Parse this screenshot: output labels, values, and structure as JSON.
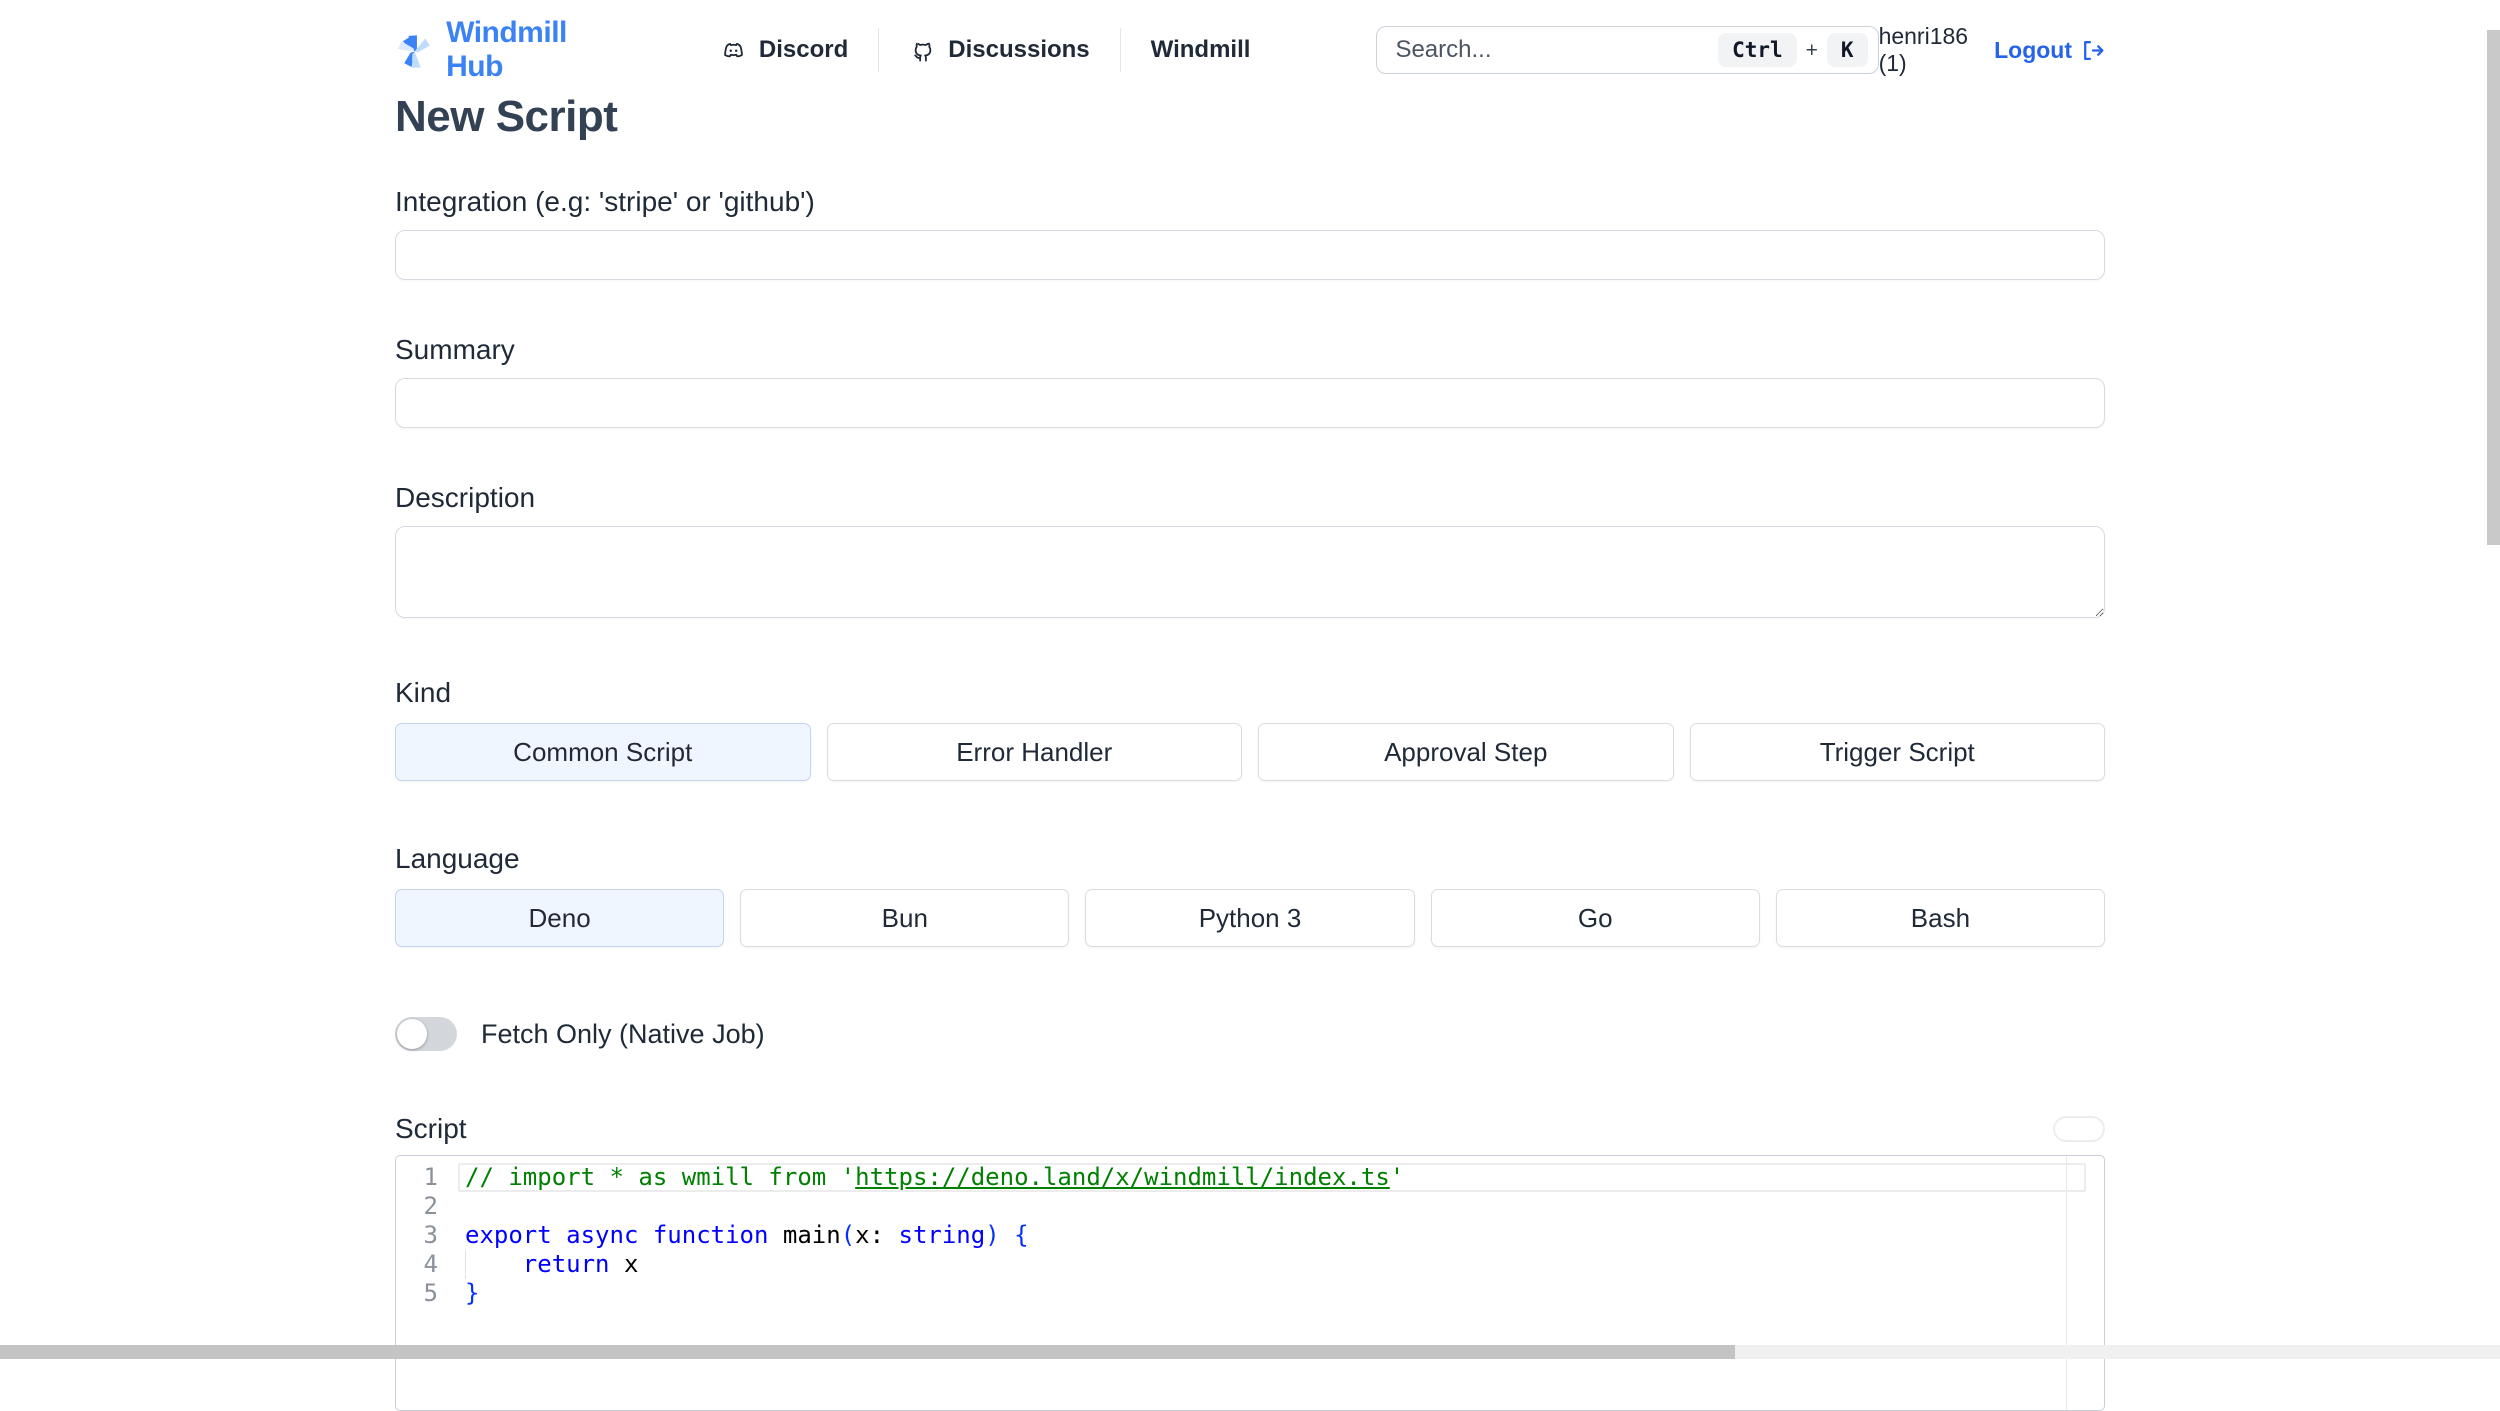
{
  "header": {
    "brand": "Windmill Hub",
    "nav": [
      {
        "label": "Discord",
        "icon": "discord-icon"
      },
      {
        "label": "Discussions",
        "icon": "github-icon"
      },
      {
        "label": "Windmill",
        "icon": null
      }
    ],
    "search": {
      "placeholder": "Search...",
      "shortcut_keys": [
        "Ctrl",
        "K"
      ],
      "shortcut_separator": "+"
    },
    "user": {
      "name": "henri186 (1)",
      "logout_label": "Logout"
    }
  },
  "page": {
    "title": "New Script"
  },
  "form": {
    "integration": {
      "label": "Integration (e.g: 'stripe' or 'github')",
      "value": ""
    },
    "summary": {
      "label": "Summary",
      "value": ""
    },
    "description": {
      "label": "Description",
      "value": ""
    },
    "kind": {
      "label": "Kind",
      "options": [
        "Common Script",
        "Error Handler",
        "Approval Step",
        "Trigger Script"
      ],
      "selected": "Common Script"
    },
    "language": {
      "label": "Language",
      "options": [
        "Deno",
        "Bun",
        "Python 3",
        "Go",
        "Bash"
      ],
      "selected": "Deno"
    },
    "fetch_only": {
      "label": "Fetch Only (Native Job)",
      "enabled": false
    },
    "script": {
      "label": "Script"
    }
  },
  "editor": {
    "token_colors": {
      "comment": "#008000",
      "keyword": "#0000ff",
      "plain": "#000000",
      "bracket": "#0431fa"
    },
    "lines": [
      {
        "number": "1",
        "current": true,
        "segments": [
          {
            "text": "// import * as wmill from '",
            "color": "comment"
          },
          {
            "text": "https://deno.land/x/windmill/index.ts",
            "color": "comment",
            "underline": true
          },
          {
            "text": "'",
            "color": "comment"
          }
        ]
      },
      {
        "number": "2",
        "segments": []
      },
      {
        "number": "3",
        "segments": [
          {
            "text": "export async function ",
            "color": "keyword"
          },
          {
            "text": "main",
            "color": "plain"
          },
          {
            "text": "(",
            "color": "bracket"
          },
          {
            "text": "x",
            "color": "plain"
          },
          {
            "text": ": ",
            "color": "plain"
          },
          {
            "text": "string",
            "color": "keyword"
          },
          {
            "text": ")",
            "color": "bracket"
          },
          {
            "text": " ",
            "color": "plain"
          },
          {
            "text": "{",
            "color": "bracket"
          }
        ]
      },
      {
        "number": "4",
        "indent_guide": true,
        "segments": [
          {
            "text": "    ",
            "color": "plain"
          },
          {
            "text": "return",
            "color": "keyword"
          },
          {
            "text": " x",
            "color": "plain"
          }
        ]
      },
      {
        "number": "5",
        "segments": [
          {
            "text": "}",
            "color": "bracket"
          }
        ]
      }
    ]
  },
  "colors": {
    "brand_blue": "#3b82f6",
    "link_blue": "#2563eb",
    "selected_bg": "#eff6ff",
    "heading": "#334155"
  }
}
